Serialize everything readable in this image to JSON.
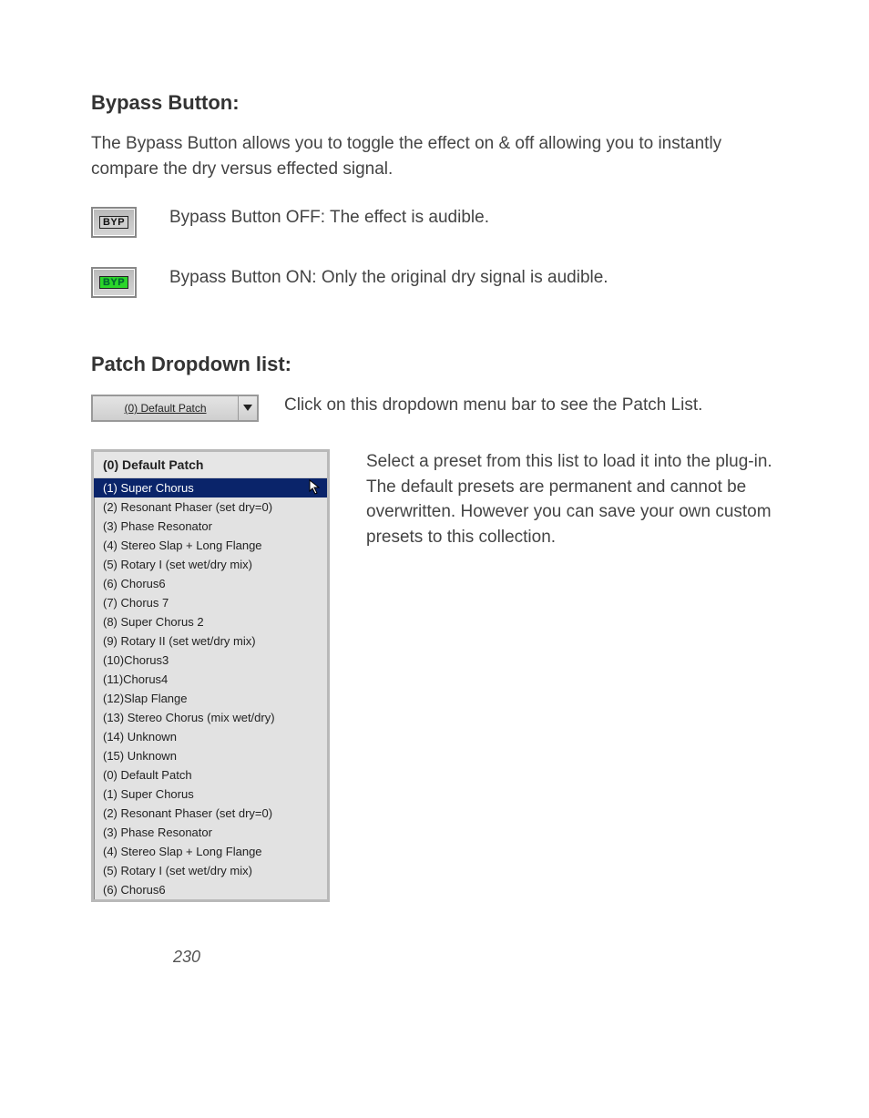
{
  "section1": {
    "title": "Bypass Button:",
    "intro": "The Bypass Button allows you to toggle the effect on & off allowing you to instantly compare the dry versus effected signal.",
    "off_label": "BYP",
    "off_text": "Bypass Button OFF:  The effect is audible.",
    "on_label": "BYP",
    "on_text": "Bypass Button ON:  Only the original dry signal is audible."
  },
  "section2": {
    "title": "Patch Dropdown list:",
    "dropdown_value": "(0) Default Patch",
    "dropdown_caption": "Click on this dropdown menu bar to see the Patch List.",
    "list_description": "Select a preset from this list to load it into the plug-in.  The default presets are permanent and cannot be overwritten.  However you can save your own custom presets to this collection.",
    "list_header": "(0) Default Patch",
    "items": [
      {
        "label": "(1) Super Chorus",
        "selected": true
      },
      {
        "label": "(2) Resonant Phaser (set dry=0)"
      },
      {
        "label": "(3) Phase Resonator"
      },
      {
        "label": "(4) Stereo Slap + Long Flange"
      },
      {
        "label": "(5) Rotary I (set wet/dry mix)"
      },
      {
        "label": "(6) Chorus6"
      },
      {
        "label": "(7) Chorus 7"
      },
      {
        "label": "(8) Super Chorus 2"
      },
      {
        "label": "(9) Rotary II (set wet/dry mix)"
      },
      {
        "label": "(10)Chorus3"
      },
      {
        "label": "(11)Chorus4"
      },
      {
        "label": "(12)Slap Flange"
      },
      {
        "label": "(13) Stereo Chorus (mix wet/dry)"
      },
      {
        "label": "(14) Unknown"
      },
      {
        "label": "(15) Unknown"
      },
      {
        "label": "(0) Default Patch"
      },
      {
        "label": "(1) Super Chorus"
      },
      {
        "label": "(2) Resonant Phaser (set dry=0)"
      },
      {
        "label": "(3) Phase Resonator"
      },
      {
        "label": "(4) Stereo Slap + Long Flange"
      },
      {
        "label": "(5) Rotary I (set wet/dry mix)"
      },
      {
        "label": "(6) Chorus6"
      }
    ]
  },
  "page_number": "230"
}
